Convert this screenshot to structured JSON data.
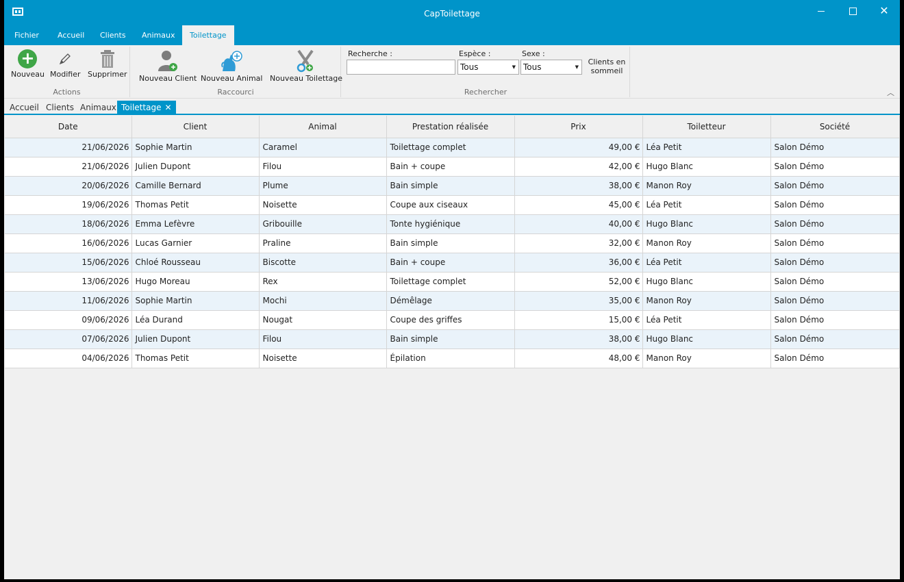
{
  "window": {
    "title": "CapToilettage"
  },
  "menu_tabs": [
    "Fichier",
    "Accueil",
    "Clients",
    "Animaux",
    "Toilettage"
  ],
  "ribbon": {
    "actions": {
      "label": "Actions",
      "new": "Nouveau",
      "edit": "Modifier",
      "delete": "Supprimer"
    },
    "shortcuts": {
      "label": "Raccourci",
      "new_client": "Nouveau Client",
      "new_animal": "Nouveau Animal",
      "new_grooming": "Nouveau Toilettage"
    },
    "search": {
      "label": "Rechercher",
      "search_label": "Recherche :",
      "search_value": "",
      "species_label": "Espèce :",
      "species_value": "Tous",
      "sex_label": "Sexe :",
      "sex_value": "Tous",
      "sleeping_clients_line1": "Clients en",
      "sleeping_clients_line2": "sommeil"
    }
  },
  "doc_tabs": [
    "Accueil",
    "Clients",
    "Animaux",
    "Toilettage"
  ],
  "grid": {
    "columns": [
      "Date",
      "Client",
      "Animal",
      "Prestation réalisée",
      "Prix",
      "Toiletteur",
      "Société"
    ],
    "rows": [
      [
        "21/06/2026",
        "Sophie Martin",
        "Caramel",
        "Toilettage complet",
        "49,00 €",
        "Léa Petit",
        "Salon Démo"
      ],
      [
        "21/06/2026",
        "Julien Dupont",
        "Filou",
        "Bain + coupe",
        "42,00 €",
        "Hugo Blanc",
        "Salon Démo"
      ],
      [
        "20/06/2026",
        "Camille Bernard",
        "Plume",
        "Bain simple",
        "38,00 €",
        "Manon Roy",
        "Salon Démo"
      ],
      [
        "19/06/2026",
        "Thomas Petit",
        "Noisette",
        "Coupe aux ciseaux",
        "45,00 €",
        "Léa Petit",
        "Salon Démo"
      ],
      [
        "18/06/2026",
        "Emma Lefèvre",
        "Gribouille",
        "Tonte hygiénique",
        "40,00 €",
        "Hugo Blanc",
        "Salon Démo"
      ],
      [
        "16/06/2026",
        "Lucas Garnier",
        "Praline",
        "Bain simple",
        "32,00 €",
        "Manon Roy",
        "Salon Démo"
      ],
      [
        "15/06/2026",
        "Chloé Rousseau",
        "Biscotte",
        "Bain + coupe",
        "36,00 €",
        "Léa Petit",
        "Salon Démo"
      ],
      [
        "13/06/2026",
        "Hugo Moreau",
        "Rex",
        "Toilettage complet",
        "52,00 €",
        "Hugo Blanc",
        "Salon Démo"
      ],
      [
        "11/06/2026",
        "Sophie Martin",
        "Mochi",
        "Démêlage",
        "35,00 €",
        "Manon Roy",
        "Salon Démo"
      ],
      [
        "09/06/2026",
        "Léa Durand",
        "Nougat",
        "Coupe des griffes",
        "15,00 €",
        "Léa Petit",
        "Salon Démo"
      ],
      [
        "07/06/2026",
        "Julien Dupont",
        "Filou",
        "Bain simple",
        "38,00 €",
        "Hugo Blanc",
        "Salon Démo"
      ],
      [
        "04/06/2026",
        "Thomas Petit",
        "Noisette",
        "Épilation",
        "48,00 €",
        "Manon Roy",
        "Salon Démo"
      ]
    ]
  },
  "colors": {
    "accent": "#0094c9",
    "row_alt": "#eaf3fa",
    "add_green": "#3fa647"
  }
}
